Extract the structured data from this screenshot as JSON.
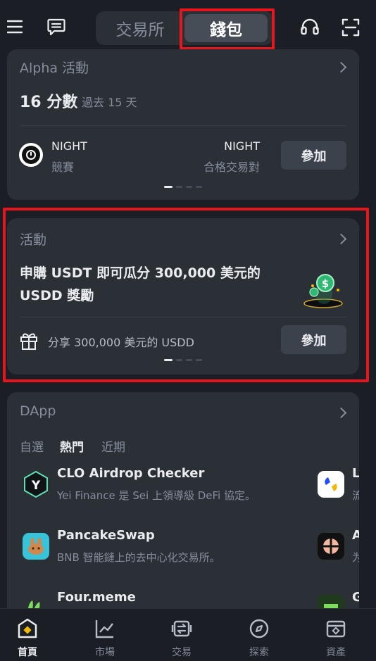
{
  "header": {
    "tabs": [
      {
        "label": "交易所"
      },
      {
        "label": "錢包"
      }
    ],
    "icons": [
      "menu-icon",
      "chat-icon",
      "headset-icon",
      "scan-icon"
    ]
  },
  "alpha": {
    "title": "Alpha 活動",
    "score": "16 分數",
    "period": "過去 15 天",
    "item": {
      "name": "NIGHT",
      "sub": "競賽",
      "right_title": "NIGHT",
      "right_sub": "合格交易對",
      "button": "參加"
    }
  },
  "activity": {
    "title": "活動",
    "headline_line1": "申購 USDT 即可瓜分 300,000 美元的",
    "headline_line2": "USDD 獎勵",
    "share_text": "分享 300,000 美元的 USDD",
    "button": "參加"
  },
  "dapp": {
    "title": "DApp",
    "filters": [
      {
        "label": "自選"
      },
      {
        "label": "熱門"
      },
      {
        "label": "近期"
      }
    ],
    "items": [
      {
        "name": "CLO Airdrop Checker",
        "desc": "Yei Finance 是 Sei 上領導級 DeFi 協定。"
      },
      {
        "name": "PancakeSwap",
        "desc": "BNB 智能鏈上的去中心化交易所。"
      },
      {
        "name": "Four.meme",
        "desc": ""
      }
    ],
    "peek": [
      {
        "name": "L",
        "desc": "流"
      },
      {
        "name": "A",
        "desc": "为"
      },
      {
        "name": "G",
        "desc": ""
      }
    ]
  },
  "nav": [
    {
      "label": "首頁"
    },
    {
      "label": "市場"
    },
    {
      "label": "交易"
    },
    {
      "label": "探索"
    },
    {
      "label": "資產"
    }
  ],
  "colors": {
    "background": "#1b1e25",
    "card": "#2b2f36",
    "highlight": "#e5161d",
    "accent": "#f0b90b"
  }
}
